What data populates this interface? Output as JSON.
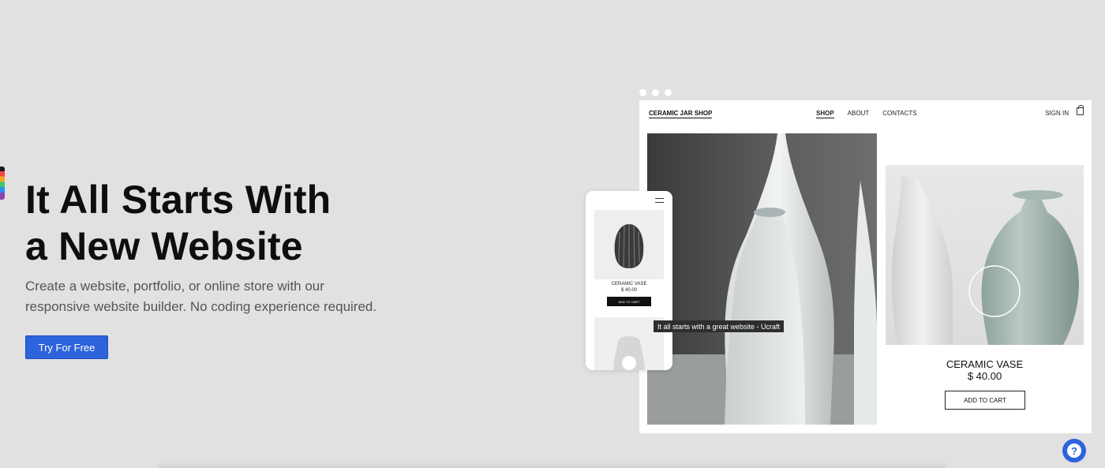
{
  "hero": {
    "title_line1": "It All Starts With",
    "title_line2": "a New Website",
    "description_line1": "Create a website, portfolio, or online store with our",
    "description_line2": "responsive website builder. No coding experience required.",
    "cta_label": "Try For Free"
  },
  "mockup": {
    "brand": "CERAMIC JAR SHOP",
    "nav": [
      "SHOP",
      "ABOUT",
      "CONTACTS"
    ],
    "sign_in": "SIGN IN",
    "product_name": "CERAMIC VASE",
    "product_price": "$ 40.00",
    "add_to_cart": "ADD TO CART",
    "cart_icon": "shopping-bag-icon"
  },
  "phone": {
    "product_name": "CERAMIC VASE",
    "product_price": "$ 40.00",
    "add_to_cart": "ADD TO CART",
    "menu_icon": "hamburger-menu-icon"
  },
  "tooltip": "It all starts with a great website - Ucraft",
  "help": {
    "icon": "help-icon",
    "glyph": "?"
  },
  "colors": {
    "background": "#e1e1e1",
    "accent": "#2d63db"
  }
}
